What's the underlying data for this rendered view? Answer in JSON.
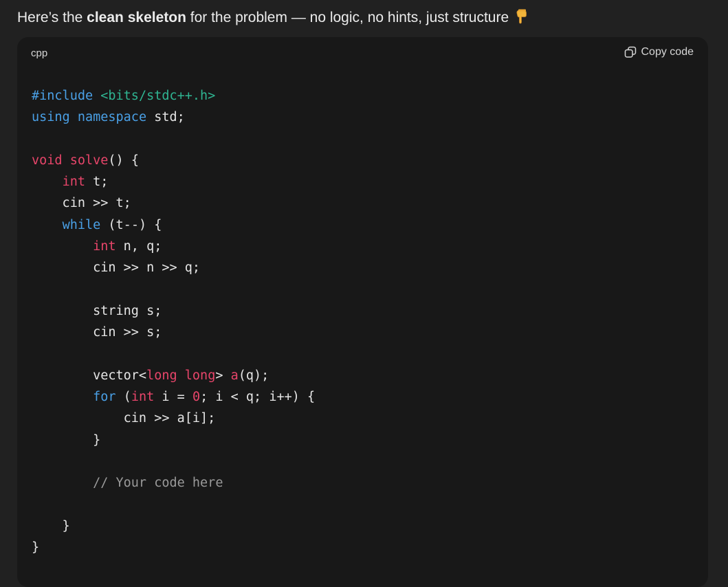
{
  "intro": {
    "prefix": "Here’s the ",
    "bold": "clean skeleton",
    "suffix": " for the problem — no logic, no hints, just structure",
    "emoji_icon": "pointing-down-hand-icon"
  },
  "code_block": {
    "language": "cpp",
    "copy_label": "Copy code",
    "lines": [
      "#include <bits/stdc++.h>",
      "using namespace std;",
      "",
      "void solve() {",
      "    int t;",
      "    cin >> t;",
      "    while (t--) {",
      "        int n, q;",
      "        cin >> n >> q;",
      "",
      "        string s;",
      "        cin >> s;",
      "",
      "        vector<long long> a(q);",
      "        for (int i = 0; i < q; i++) {",
      "            cin >> a[i];",
      "        }",
      "",
      "        // Your code here",
      "",
      "    }",
      "}"
    ]
  },
  "colors": {
    "background": "#212121",
    "code_background": "#181818",
    "keyword_blue": "#4aa0e6",
    "keyword_red": "#e8456a",
    "string_green": "#2fb592",
    "comment_gray": "#9a9a9a"
  }
}
